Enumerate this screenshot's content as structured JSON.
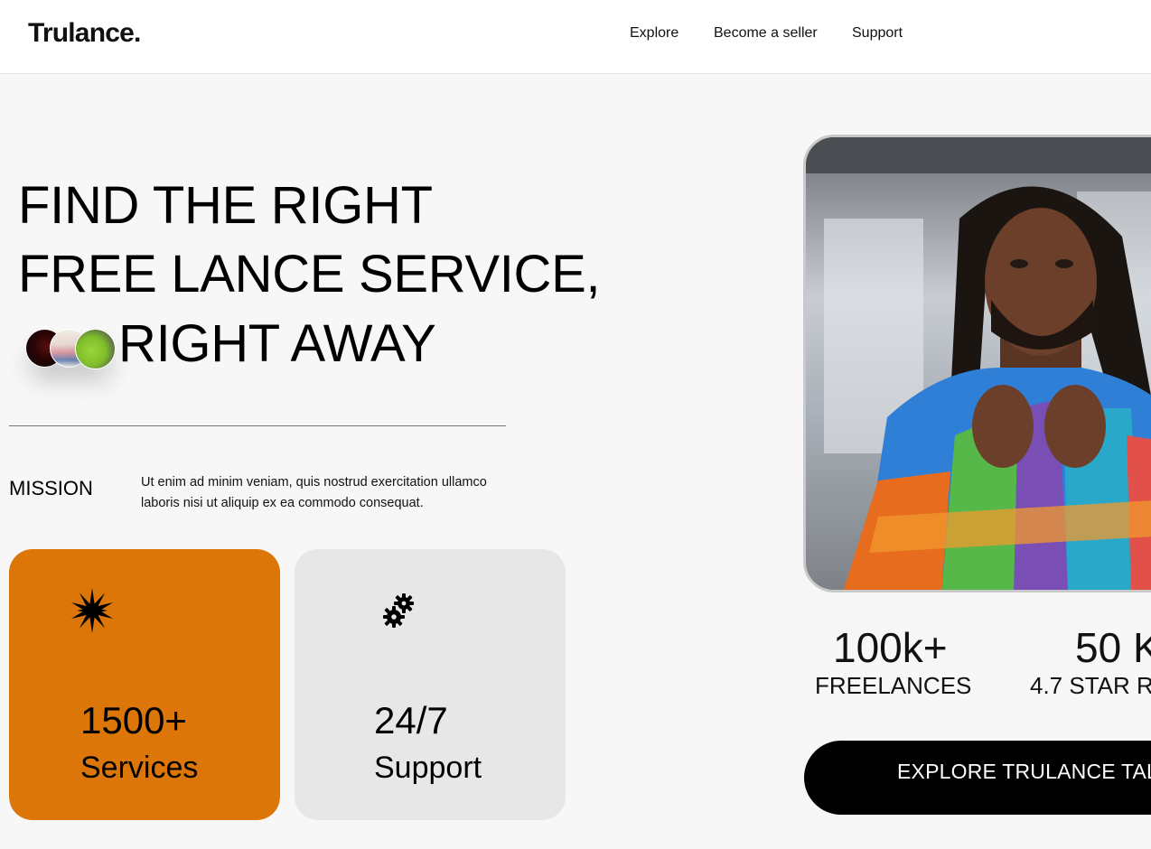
{
  "header": {
    "logo": "Trulance.",
    "nav": [
      "Explore",
      "Become a seller",
      "Support"
    ]
  },
  "hero": {
    "line1": "FIND THE RIGHT",
    "line2": "FREE LANCE SERVICE,",
    "line3": "RIGHT AWAY"
  },
  "mission": {
    "label": "MISSION",
    "text": "Ut enim ad minim veniam, quis nostrud exercitation ullamco laboris nisi ut aliquip ex ea commodo consequat."
  },
  "cards": [
    {
      "value": "1500+",
      "label": "Services",
      "icon": "starburst-icon",
      "color": "#dc7609"
    },
    {
      "value": "24/7",
      "label": "Support",
      "icon": "gear-cluster-icon",
      "color": "#e7e7e7"
    }
  ],
  "stats": [
    {
      "value": "100k+",
      "label": "FREELANCES"
    },
    {
      "value": "50 K",
      "label": "4.7 STAR R"
    }
  ],
  "cta": {
    "label": "EXPLORE TRULANCE TALE"
  },
  "colors": {
    "accent": "#dc7609",
    "background": "#f7f7f7",
    "button": "#000000"
  }
}
